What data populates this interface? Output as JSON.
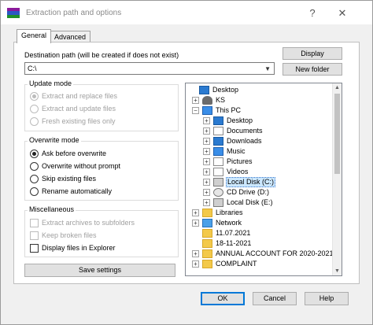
{
  "window": {
    "title": "Extraction path and options",
    "help": "?",
    "close": "✕"
  },
  "tabs": [
    "General",
    "Advanced"
  ],
  "destination": {
    "label": "Destination path (will be created if does not exist)",
    "value": "C:\\",
    "display_button": "Display",
    "new_folder_button": "New folder"
  },
  "update_mode": {
    "title": "Update mode",
    "options": [
      {
        "label": "Extract and replace files",
        "selected": true,
        "enabled": false
      },
      {
        "label": "Extract and update files",
        "selected": false,
        "enabled": false
      },
      {
        "label": "Fresh existing files only",
        "selected": false,
        "enabled": false
      }
    ]
  },
  "overwrite_mode": {
    "title": "Overwrite mode",
    "options": [
      {
        "label": "Ask before overwrite",
        "selected": true
      },
      {
        "label": "Overwrite without prompt",
        "selected": false
      },
      {
        "label": "Skip existing files",
        "selected": false
      },
      {
        "label": "Rename automatically",
        "selected": false
      }
    ]
  },
  "misc": {
    "title": "Miscellaneous",
    "options": [
      {
        "label": "Extract archives to subfolders",
        "checked": false,
        "enabled": false
      },
      {
        "label": "Keep broken files",
        "checked": false,
        "enabled": false
      },
      {
        "label": "Display files in Explorer",
        "checked": false,
        "enabled": true
      }
    ]
  },
  "save_settings": "Save settings",
  "tree": [
    {
      "label": "Desktop",
      "icon": "desktop-icon",
      "expander": ""
    },
    {
      "label": "KS",
      "icon": "user-icon",
      "expander": "+"
    },
    {
      "label": "This PC",
      "icon": "computer-icon",
      "expander": "−"
    },
    {
      "label": "Desktop",
      "icon": "desktop-icon",
      "expander": "+"
    },
    {
      "label": "Documents",
      "icon": "documents-icon",
      "expander": "+"
    },
    {
      "label": "Downloads",
      "icon": "downloads-icon",
      "expander": "+"
    },
    {
      "label": "Music",
      "icon": "music-icon",
      "expander": "+"
    },
    {
      "label": "Pictures",
      "icon": "pictures-icon",
      "expander": "+"
    },
    {
      "label": "Videos",
      "icon": "videos-icon",
      "expander": "+"
    },
    {
      "label": "Local Disk (C:)",
      "icon": "local-disk-icon",
      "expander": "+",
      "selected": true
    },
    {
      "label": "CD Drive (D:)",
      "icon": "cd-drive-icon",
      "expander": "+"
    },
    {
      "label": "Local Disk (E:)",
      "icon": "local-disk-icon",
      "expander": "+"
    },
    {
      "label": "Libraries",
      "icon": "libraries-icon",
      "expander": "+"
    },
    {
      "label": "Network",
      "icon": "network-icon",
      "expander": "+"
    },
    {
      "label": "11.07.2021",
      "icon": "folder-icon",
      "expander": ""
    },
    {
      "label": "18-11-2021",
      "icon": "folder-icon",
      "expander": ""
    },
    {
      "label": "ANNUAL ACCOUNT FOR 2020-2021",
      "icon": "folder-icon",
      "expander": "+"
    },
    {
      "label": "COMPLAINT",
      "icon": "folder-icon",
      "expander": "+"
    }
  ],
  "footer": {
    "ok": "OK",
    "cancel": "Cancel",
    "help": "Help"
  }
}
